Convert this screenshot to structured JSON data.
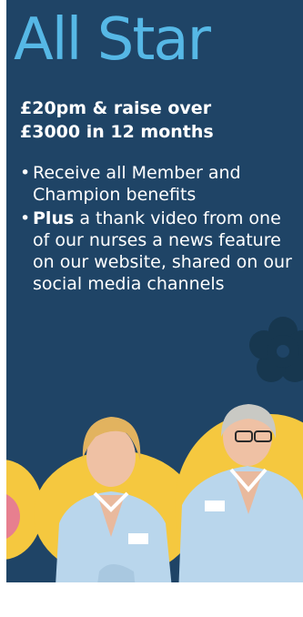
{
  "header": {
    "title": "All Star",
    "subtitle_line1": "£20pm & raise over",
    "subtitle_line2": "£3000 in 12 months"
  },
  "benefits": {
    "item1": "Receive all Member and Champion benefits",
    "item2_bold": "Plus",
    "item2_rest": " a thank video from one of our nurses a news feature on our website, shared on our social media channels"
  },
  "icons": [
    "flower-icon"
  ],
  "colors": {
    "background": "#1f4466",
    "title": "#56b8e6",
    "accent_yellow": "#f5c83f",
    "accent_pink": "#e77f8f",
    "uniform_blue": "#b9d6ec"
  }
}
